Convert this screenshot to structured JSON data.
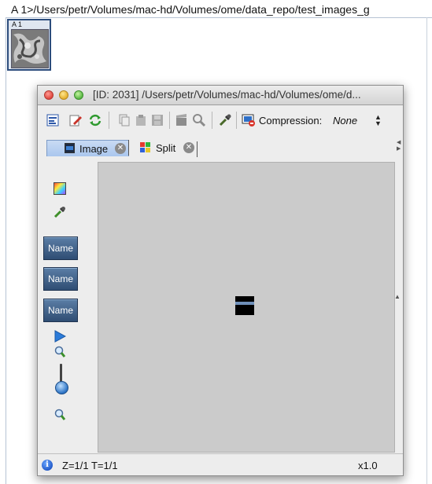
{
  "top_path": "A 1>/Users/petr/Volumes/mac-hd/Volumes/ome/data_repo/test_images_g",
  "thumbnail": {
    "label": "A 1"
  },
  "window": {
    "title": "[ID: 2031] /Users/petr/Volumes/mac-hd/Volumes/ome/d..."
  },
  "toolbar": {
    "compression_label": "Compression:",
    "compression_value": "None"
  },
  "tabs": [
    {
      "label": "Image",
      "selected": true
    },
    {
      "label": "Split",
      "selected": false
    }
  ],
  "sidepanel": {
    "channel_buttons": [
      "Name",
      "Name",
      "Name"
    ]
  },
  "status": {
    "zt": "Z=1/1 T=1/1",
    "zoom": "x1.0"
  },
  "colors": {
    "accent": "#2c4c7c",
    "channel_button": "#3d5f88",
    "canvas_bg": "#cbcbcb"
  }
}
